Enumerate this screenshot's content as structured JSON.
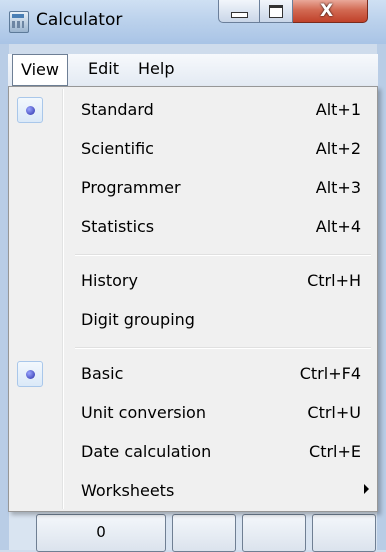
{
  "window": {
    "title": "Calculator"
  },
  "menubar": {
    "view": "View",
    "edit": "Edit",
    "help": "Help"
  },
  "view_menu": {
    "group1": [
      {
        "label": "Standard",
        "shortcut": "Alt+1",
        "checked": true
      },
      {
        "label": "Scientific",
        "shortcut": "Alt+2",
        "checked": false
      },
      {
        "label": "Programmer",
        "shortcut": "Alt+3",
        "checked": false
      },
      {
        "label": "Statistics",
        "shortcut": "Alt+4",
        "checked": false
      }
    ],
    "group2": [
      {
        "label": "History",
        "shortcut": "Ctrl+H"
      },
      {
        "label": "Digit grouping",
        "shortcut": ""
      }
    ],
    "group3": [
      {
        "label": "Basic",
        "shortcut": "Ctrl+F4",
        "checked": true
      },
      {
        "label": "Unit conversion",
        "shortcut": "Ctrl+U",
        "checked": false
      },
      {
        "label": "Date calculation",
        "shortcut": "Ctrl+E",
        "checked": false
      },
      {
        "label": "Worksheets",
        "shortcut": "",
        "submenu": true
      }
    ]
  },
  "calc_keys": [
    "0",
    "",
    "",
    ""
  ]
}
